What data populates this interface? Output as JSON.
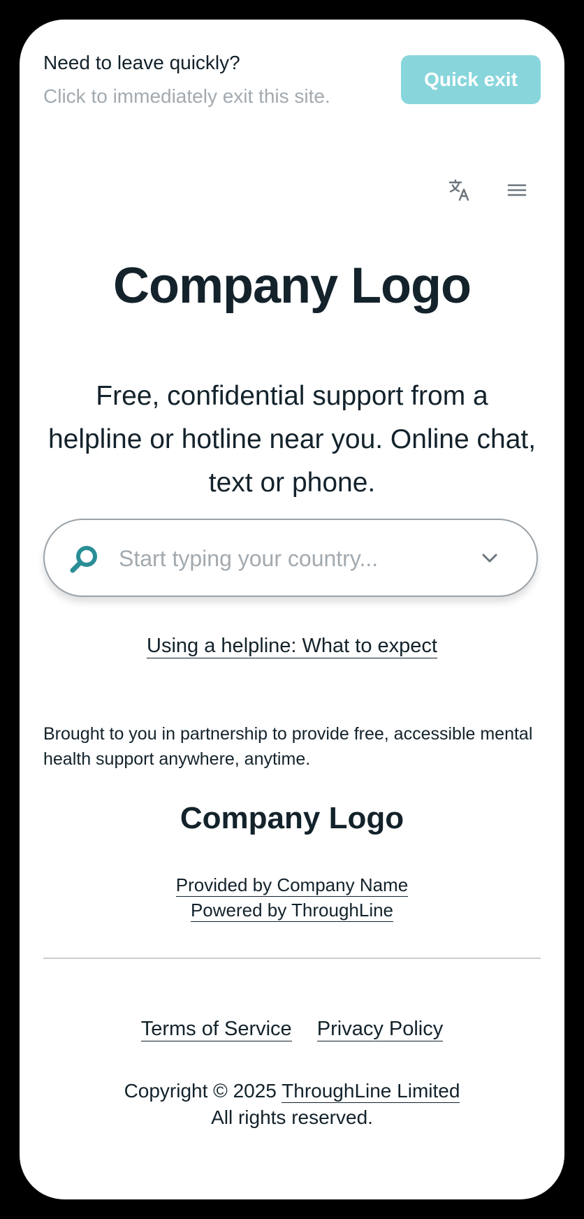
{
  "quick_exit": {
    "title": "Need to leave quickly?",
    "subtitle": "Click to immediately exit this site.",
    "button_label": "Quick exit"
  },
  "header": {
    "translate_icon": "translate-icon",
    "menu_icon": "hamburger-menu-icon"
  },
  "hero": {
    "logo_text": "Company Logo",
    "tagline": "Free, confidential support from a helpline or hotline near you. Online chat, text or phone."
  },
  "search": {
    "placeholder": "Start typing your country...",
    "value": "",
    "icon": "search-icon",
    "dropdown_icon": "chevron-down-icon"
  },
  "links": {
    "what_to_expect": "Using a helpline: What to expect"
  },
  "partner": {
    "text": "Brought to you in partnership to provide free, accessible mental health support anywhere, anytime.",
    "logo_text": "Company Logo",
    "provided_by": "Provided by Company Name",
    "powered_by": "Powered by ThroughLine"
  },
  "footer": {
    "terms": "Terms of Service",
    "privacy": "Privacy Policy",
    "copyright_prefix": "Copyright © 2025",
    "copyright_link": "ThroughLine Limited",
    "rights": "All rights reserved."
  },
  "colors": {
    "accent": "#88d5dc",
    "search_icon": "#2a8e96",
    "text": "#13222b",
    "muted": "#a2aab0"
  }
}
